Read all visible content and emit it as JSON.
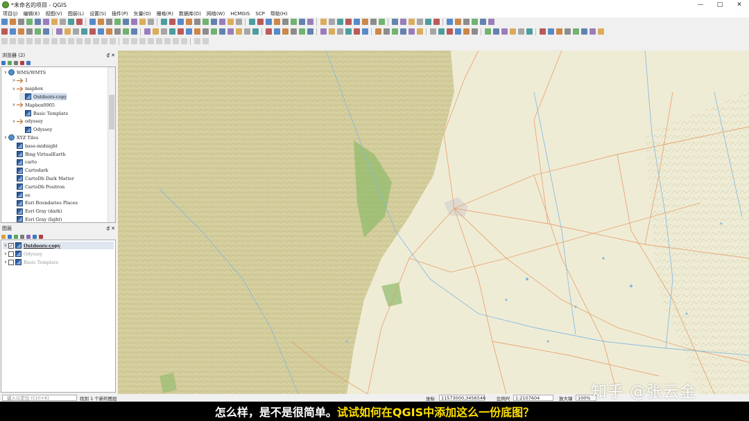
{
  "window": {
    "title": "*未命名的项目 - QGIS",
    "min": "—",
    "max": "□",
    "close": "✕"
  },
  "menu": [
    "项目(J)",
    "编辑(E)",
    "视图(V)",
    "图层(L)",
    "设置(S)",
    "插件(P)",
    "矢量(O)",
    "栅格(R)",
    "数据库(D)",
    "网络(W)",
    "HCMGIS",
    "SCP",
    "帮助(H)"
  ],
  "browser": {
    "title": "浏览器 (2)",
    "controls": "₫ ✕",
    "items": [
      {
        "label": "WMS/WMTS",
        "level": 0,
        "icon": "globe-icon",
        "arrow": "∨"
      },
      {
        "label": "1",
        "level": 1,
        "icon": "wms-icon",
        "arrow": ">"
      },
      {
        "label": "mapbox",
        "level": 1,
        "icon": "wms-icon",
        "arrow": "∨"
      },
      {
        "label": "Outdoors-copy",
        "level": 2,
        "icon": "tile-icon",
        "arrow": "",
        "selected": true
      },
      {
        "label": "Mapbox0905",
        "level": 1,
        "icon": "wms-icon",
        "arrow": "∨"
      },
      {
        "label": "Basic Template",
        "level": 2,
        "icon": "tile-icon",
        "arrow": ""
      },
      {
        "label": "odyssey",
        "level": 1,
        "icon": "wms-icon",
        "arrow": "∨"
      },
      {
        "label": "Odyssey",
        "level": 2,
        "icon": "tile-icon",
        "arrow": ""
      },
      {
        "label": "XYZ Tiles",
        "level": 0,
        "icon": "globe-icon",
        "arrow": "∨"
      },
      {
        "label": "base-midnight",
        "level": 1,
        "icon": "tile-icon",
        "arrow": ""
      },
      {
        "label": "Bing VirtualEarth",
        "level": 1,
        "icon": "tile-icon",
        "arrow": ""
      },
      {
        "label": "carto",
        "level": 1,
        "icon": "tile-icon",
        "arrow": ""
      },
      {
        "label": "Cartodark",
        "level": 1,
        "icon": "tile-icon",
        "arrow": ""
      },
      {
        "label": "CartoDb Dark Matter",
        "level": 1,
        "icon": "tile-icon",
        "arrow": ""
      },
      {
        "label": "CartoDb Positron",
        "level": 1,
        "icon": "tile-icon",
        "arrow": ""
      },
      {
        "label": "ee",
        "level": 1,
        "icon": "tile-icon",
        "arrow": ""
      },
      {
        "label": "Esri Boundaries Places",
        "level": 1,
        "icon": "tile-icon",
        "arrow": ""
      },
      {
        "label": "Esri Gray (dark)",
        "level": 1,
        "icon": "tile-icon",
        "arrow": ""
      },
      {
        "label": "Esri Gray (light)",
        "level": 1,
        "icon": "tile-icon",
        "arrow": ""
      }
    ]
  },
  "layers": {
    "title": "图层",
    "controls": "₫ ✕",
    "items": [
      {
        "label": "Outdoors-copy",
        "checked": true,
        "selected": true,
        "check": "✓"
      },
      {
        "label": "Odyssey",
        "checked": false,
        "selected": false,
        "check": ""
      },
      {
        "label": "Basic Template",
        "checked": false,
        "selected": false,
        "check": ""
      }
    ]
  },
  "status": {
    "locator": "键入以定位 (Ctrl+K)",
    "message": "找到 1 个新的图层",
    "coord_label": "坐标",
    "coord": "11573000,3456546",
    "scale_label": "比例尺",
    "scale": "1:2107604",
    "magnifier_label": "放大镜",
    "magnifier": "100%"
  },
  "subtitle": {
    "part1": "怎么样，是不是很简单。",
    "part2": "试试如何在QGIS中添加这么一份底图？"
  },
  "watermark": "知乎 @张云金",
  "colors": {
    "accent": "#3c78c3",
    "subtitle_white": "#ffffff",
    "subtitle_yellow": "#ffe000",
    "map_mountain": "#d2cb97",
    "map_plain": "#efecd6",
    "map_road": "#e69a62",
    "map_river": "#7fb8de",
    "map_forest": "#8fba6a"
  }
}
